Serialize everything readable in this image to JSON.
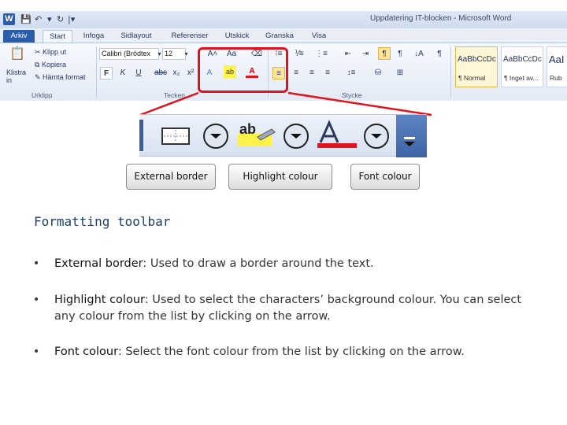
{
  "word": {
    "title": "Uppdatering IT-blocken - Microsoft Word",
    "app_letter": "W",
    "tabs": [
      "Arkiv",
      "Start",
      "Infoga",
      "Sidlayout",
      "Referenser",
      "Utskick",
      "Granska",
      "Visa"
    ],
    "clipboard": {
      "paste": "Klistra in",
      "cut": "Klipp ut",
      "copy": "Kopiera",
      "format_painter": "Hämta format",
      "group": "Urklipp"
    },
    "font": {
      "name": "Calibri (Brödtex",
      "size": "12",
      "bold": "F",
      "italic": "K",
      "underline": "U",
      "strike": "abc",
      "subscript": "x₂",
      "superscript": "x²",
      "group": "Tecken"
    },
    "paragraph": {
      "group": "Stycke"
    },
    "styles": [
      {
        "preview": "AaBbCcDc",
        "name": "¶ Normal"
      },
      {
        "preview": "AaBbCcDc",
        "name": "¶ Inget av..."
      },
      {
        "preview": "AaI",
        "name": "Rub"
      }
    ]
  },
  "callouts": {
    "external_border": "External border",
    "highlight_colour": "Highlight colour",
    "font_colour": "Font colour"
  },
  "colors": {
    "red": "#e0141e",
    "heading": "#1f3f6a",
    "accent_blue": "#2a5caa"
  },
  "content": {
    "heading": "Formatting toolbar",
    "bullets": [
      {
        "term": "External border",
        "desc": ": Used to draw a border around the text."
      },
      {
        "term": "Highlight colour",
        "desc": ": Used to select the characters’ background colour. You can select any colour from the list by clicking on the arrow."
      },
      {
        "term": "Font colour",
        "desc": ": Select the font colour from the list by clicking on the arrow."
      }
    ]
  }
}
